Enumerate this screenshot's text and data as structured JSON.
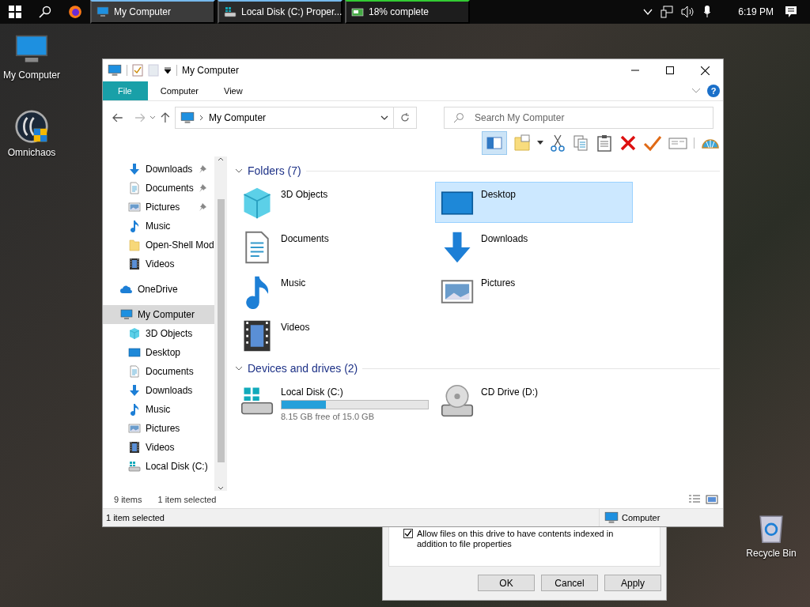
{
  "taskbar": {
    "apps": [
      {
        "label": "My Computer",
        "kind": "pc",
        "selected": true
      },
      {
        "label": "Local Disk (C:) Proper...",
        "kind": "disk",
        "selected": false
      },
      {
        "label": "18% complete",
        "kind": "copy",
        "selected": false
      }
    ],
    "time": "6:19 PM"
  },
  "desktop_icons": [
    {
      "label": "My Computer",
      "kind": "pc"
    },
    {
      "label": "Omnichaos",
      "kind": "app"
    },
    {
      "label": "Recycle Bin",
      "kind": "bin"
    }
  ],
  "dialog": {
    "checkbox": {
      "label": "Allow files on this drive to have contents indexed in addition to file properties",
      "checked": true
    },
    "buttons": [
      "OK",
      "Cancel",
      "Apply"
    ]
  },
  "window": {
    "title": "My Computer",
    "ribbon_tabs": [
      {
        "label": "File",
        "kind": "file",
        "selected": false
      },
      {
        "label": "Computer",
        "kind": "tab",
        "selected": false
      },
      {
        "label": "View",
        "kind": "tab",
        "selected": false
      }
    ],
    "address": "My Computer",
    "search": {
      "placeholder": "Search My Computer"
    },
    "help": "?",
    "sidebar": {
      "quick_access": [
        {
          "label": "Downloads",
          "kind": "download",
          "pinned": true,
          "selected": false
        },
        {
          "label": "Documents",
          "kind": "document",
          "pinned": true,
          "selected": false
        },
        {
          "label": "Pictures",
          "kind": "picture",
          "pinned": true,
          "selected": false
        },
        {
          "label": "Music",
          "kind": "music",
          "pinned": false,
          "selected": false
        },
        {
          "label": "Open-Shell Mod",
          "kind": "folder",
          "pinned": false,
          "selected": false
        },
        {
          "label": "Videos",
          "kind": "video",
          "pinned": false,
          "selected": false
        }
      ],
      "roots": [
        {
          "label": "OneDrive",
          "kind": "cloud",
          "selected": false
        },
        {
          "label": "My Computer",
          "kind": "pc",
          "selected": true,
          "children": [
            {
              "label": "3D Objects",
              "kind": "cube",
              "selected": false
            },
            {
              "label": "Desktop",
              "kind": "desktop",
              "selected": false
            },
            {
              "label": "Documents",
              "kind": "document",
              "selected": false
            },
            {
              "label": "Downloads",
              "kind": "download",
              "selected": false
            },
            {
              "label": "Music",
              "kind": "music",
              "selected": false
            },
            {
              "label": "Pictures",
              "kind": "picture",
              "selected": false
            },
            {
              "label": "Videos",
              "kind": "video",
              "selected": false
            },
            {
              "label": "Local Disk (C:)",
              "kind": "disk",
              "selected": false
            }
          ]
        }
      ]
    },
    "sections": [
      {
        "title": "Folders (7)",
        "items": [
          {
            "label": "3D Objects",
            "kind": "cube",
            "selected": false
          },
          {
            "label": "Desktop",
            "kind": "desktop",
            "selected": true
          },
          {
            "label": "Documents",
            "kind": "document",
            "selected": false
          },
          {
            "label": "Downloads",
            "kind": "download",
            "selected": false
          },
          {
            "label": "Music",
            "kind": "music",
            "selected": false
          },
          {
            "label": "Pictures",
            "kind": "picture",
            "selected": false
          },
          {
            "label": "Videos",
            "kind": "video",
            "selected": false
          }
        ]
      },
      {
        "title": "Devices and drives (2)",
        "items": [
          {
            "label": "Local Disk (C:)",
            "kind": "disk",
            "selected": false,
            "level": 0.3,
            "detail": "8.15 GB free of 15.0 GB"
          },
          {
            "label": "CD Drive (D:)",
            "kind": "cd",
            "selected": false
          }
        ]
      }
    ],
    "item_count": "9 items",
    "selection_count": "1 item selected",
    "status_bar": {
      "left": "1 item selected",
      "right": "Computer"
    }
  }
}
